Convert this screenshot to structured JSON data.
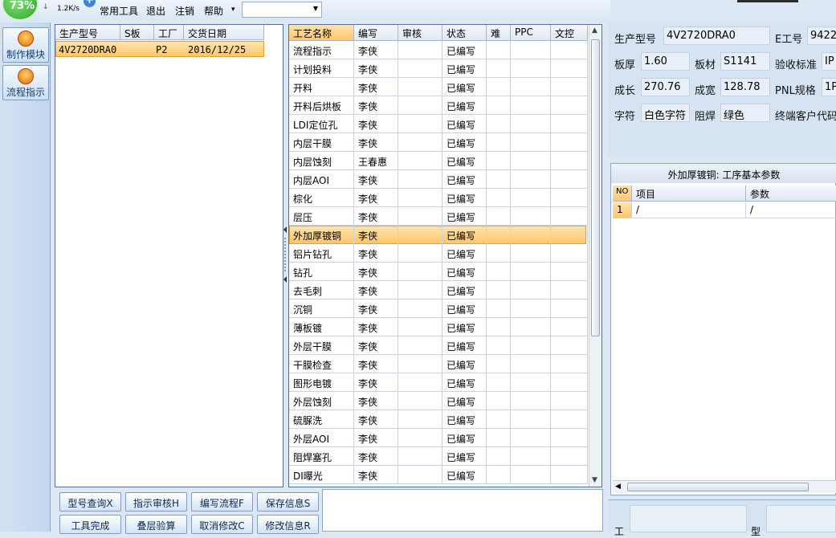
{
  "speed_widget": {
    "percent": "73%",
    "rate": "1.2K/s",
    "arrow": "↓",
    "plus": "+"
  },
  "menubar": {
    "items": [
      "常用工具",
      "退出",
      "注销",
      "帮助"
    ],
    "help_dropdown": "▾",
    "select_value": ""
  },
  "left_rail": {
    "buttons": [
      {
        "label": "制作模块",
        "icon": "fire-icon"
      },
      {
        "label": "流程指示",
        "icon": "flow-icon"
      }
    ]
  },
  "product_list": {
    "columns": [
      "生产型号",
      "S板",
      "工厂",
      "交货日期"
    ],
    "rows": [
      {
        "model": "4V2720DRA0",
        "s_board": "",
        "factory": "P2",
        "delivery": "2016/12/25"
      }
    ]
  },
  "process_grid": {
    "columns": [
      "工艺名称",
      "编写",
      "审核",
      "状态",
      "难",
      "PPC",
      "文控"
    ],
    "selected_index": 10,
    "rows": [
      {
        "name": "流程指示",
        "writer": "李侠",
        "status": "已编写"
      },
      {
        "name": "计划投料",
        "writer": "李侠",
        "status": "已编写"
      },
      {
        "name": "开料",
        "writer": "李侠",
        "status": "已编写"
      },
      {
        "name": "开料后烘板",
        "writer": "李侠",
        "status": "已编写"
      },
      {
        "name": "LDI定位孔",
        "writer": "李侠",
        "status": "已编写"
      },
      {
        "name": "内层干膜",
        "writer": "李侠",
        "status": "已编写"
      },
      {
        "name": "内层蚀刻",
        "writer": "王春惠",
        "status": "已编写"
      },
      {
        "name": "内层AOI",
        "writer": "李侠",
        "status": "已编写"
      },
      {
        "name": "棕化",
        "writer": "李侠",
        "status": "已编写"
      },
      {
        "name": "层压",
        "writer": "李侠",
        "status": "已编写"
      },
      {
        "name": "外加厚镀铜",
        "writer": "李侠",
        "status": "已编写"
      },
      {
        "name": "铝片钻孔",
        "writer": "李侠",
        "status": "已编写"
      },
      {
        "name": "钻孔",
        "writer": "李侠",
        "status": "已编写"
      },
      {
        "name": "去毛刺",
        "writer": "李侠",
        "status": "已编写"
      },
      {
        "name": "沉铜",
        "writer": "李侠",
        "status": "已编写"
      },
      {
        "name": "薄板镀",
        "writer": "李侠",
        "status": "已编写"
      },
      {
        "name": "外层干膜",
        "writer": "李侠",
        "status": "已编写"
      },
      {
        "name": "干膜检查",
        "writer": "李侠",
        "status": "已编写"
      },
      {
        "name": "图形电镀",
        "writer": "李侠",
        "status": "已编写"
      },
      {
        "name": "外层蚀刻",
        "writer": "李侠",
        "status": "已编写"
      },
      {
        "name": "硫脲洗",
        "writer": "李侠",
        "status": "已编写"
      },
      {
        "name": "外层AOI",
        "writer": "李侠",
        "status": "已编写"
      },
      {
        "name": "阻焊塞孔",
        "writer": "李侠",
        "status": "已编写"
      },
      {
        "name": "DI曝光",
        "writer": "李侠",
        "status": "已编写"
      }
    ]
  },
  "actions": {
    "row1": [
      "型号查询X",
      "指示审核H",
      "编写流程F",
      "保存信息S"
    ],
    "row2": [
      "工具完成",
      "叠层验算",
      "取消修改C",
      "修改信息R"
    ]
  },
  "details": {
    "model_label": "生产型号",
    "model_value": "4V2720DRA0",
    "eno_label": "E工号",
    "eno_value": "9422",
    "thickness_label": "板厚",
    "thickness_value": "1.60",
    "material_label": "板材",
    "material_value": "S1141",
    "standard_label": "验收标准",
    "standard_value": "IP",
    "length_label": "成长",
    "length_value": "270.76",
    "width_label": "成宽",
    "width_value": "128.78",
    "pnl_label": "PNL规格",
    "pnl_value": "1P",
    "char_label": "字符",
    "char_value": "白色字符",
    "mask_label": "阻焊",
    "mask_value": "绿色",
    "customer_label": "终端客户代码"
  },
  "params": {
    "title": "外加厚镀铜: 工序基本参数",
    "columns": [
      "NO",
      "项目",
      "参数"
    ],
    "rows": [
      {
        "no": "1",
        "item": "/",
        "value": "/"
      }
    ]
  },
  "bottom_right": {
    "label_left": "工",
    "label_right": "型"
  }
}
